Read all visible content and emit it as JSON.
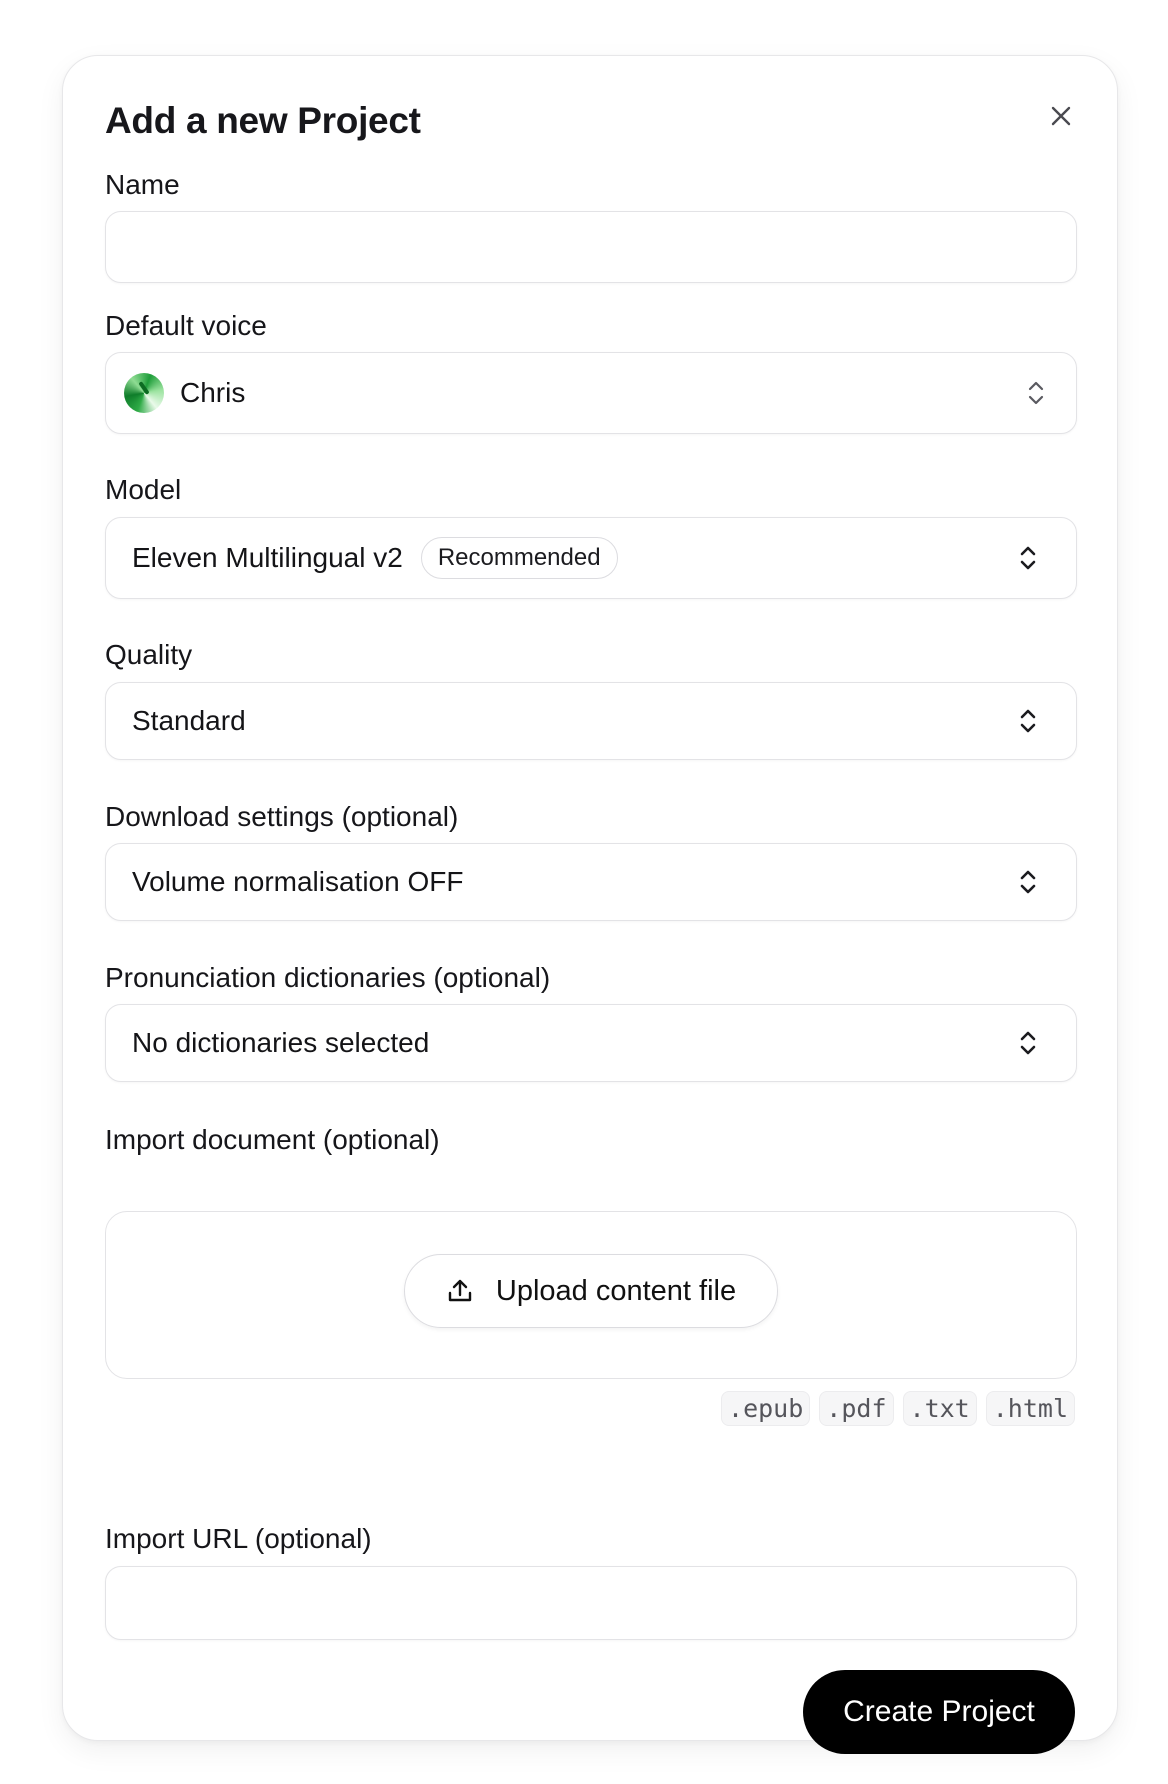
{
  "dialog": {
    "title": "Add a new Project",
    "close_icon": "close-icon"
  },
  "fields": {
    "name": {
      "label": "Name",
      "value": "",
      "placeholder": ""
    },
    "default_voice": {
      "label": "Default voice",
      "value": "Chris",
      "avatar_icon": "voice-avatar"
    },
    "model": {
      "label": "Model",
      "value": "Eleven Multilingual v2",
      "badge": "Recommended"
    },
    "quality": {
      "label": "Quality",
      "value": "Standard"
    },
    "download_settings": {
      "label": "Download settings (optional)",
      "value": "Volume normalisation OFF"
    },
    "pronunciation": {
      "label": "Pronunciation dictionaries (optional)",
      "value": "No dictionaries selected"
    },
    "import_document": {
      "label": "Import document (optional)",
      "upload_label": "Upload content file",
      "upload_icon": "upload-icon",
      "extensions": [
        ".epub",
        ".pdf",
        ".txt",
        ".html"
      ]
    },
    "import_url": {
      "label": "Import URL (optional)",
      "value": "",
      "placeholder": ""
    }
  },
  "actions": {
    "create_label": "Create Project"
  },
  "colors": {
    "primary_button": "#000000",
    "border": "#e3e3e6",
    "accent_avatar": "#1f9d3a"
  }
}
